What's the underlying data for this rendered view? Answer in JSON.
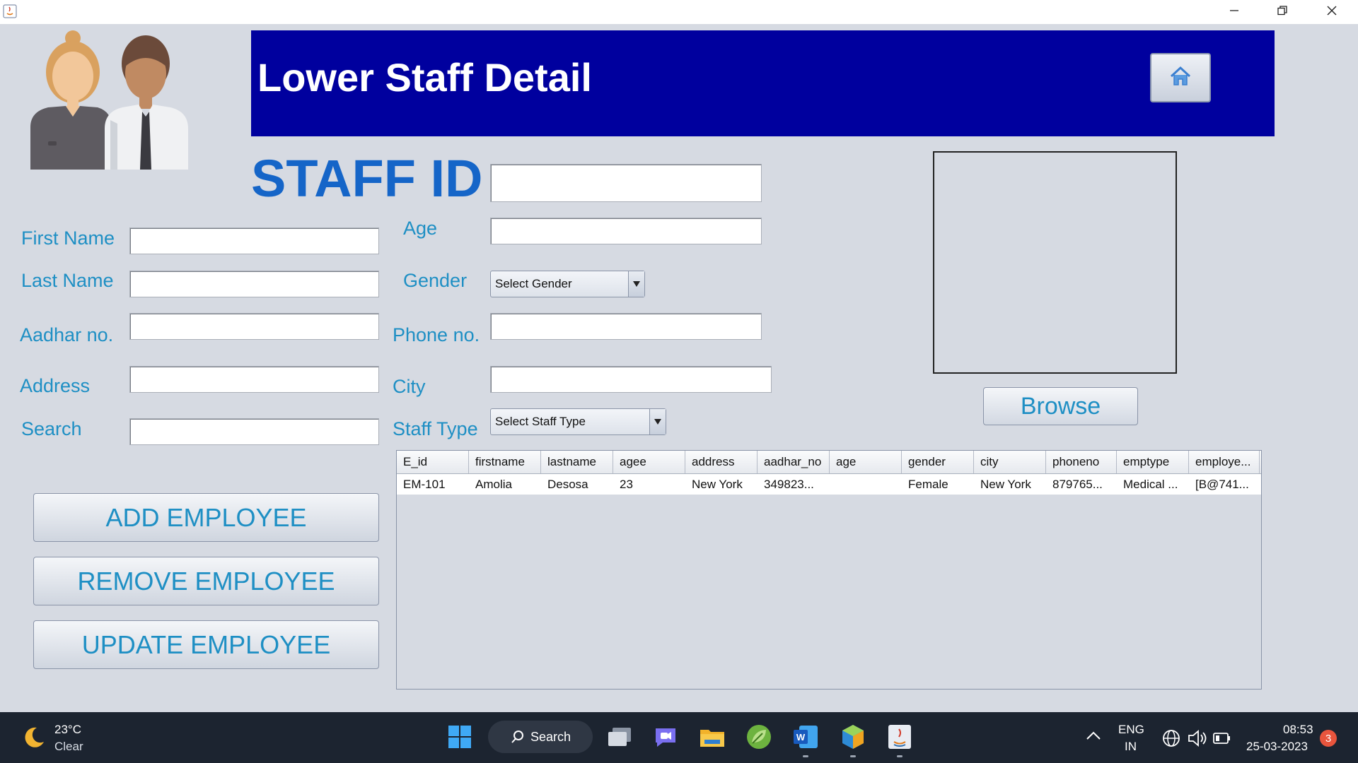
{
  "window": {
    "controls": {
      "minimize": "minimize-icon",
      "restore": "restore-icon",
      "close": "close-icon"
    }
  },
  "header": {
    "title": "Lower Staff Detail",
    "home_icon": "home-icon",
    "bg_color": "#00009e"
  },
  "form": {
    "staff_id_label": "STAFF ID",
    "staff_id_value": "",
    "labels": {
      "first_name": "First Name",
      "last_name": "Last Name",
      "aadhar": "Aadhar no.",
      "address": "Address",
      "search": "Search",
      "age": "Age",
      "gender": "Gender",
      "phone": "Phone no.",
      "city": "City",
      "staff_type": "Staff Type"
    },
    "values": {
      "first_name": "",
      "last_name": "",
      "aadhar": "",
      "address": "",
      "search": "",
      "age": "",
      "phone": "",
      "city": ""
    },
    "gender_select": "Select Gender",
    "staff_type_select": "Select Staff Type"
  },
  "photo": {
    "browse_label": "Browse"
  },
  "actions": {
    "add": "ADD EMPLOYEE",
    "remove": "REMOVE EMPLOYEE",
    "update": "UPDATE EMPLOYEE"
  },
  "table": {
    "columns": [
      "E_id",
      "firstname",
      "lastname",
      "agee",
      "address",
      "aadhar_no",
      "age",
      "gender",
      "city",
      "phoneno",
      "emptype",
      "employe..."
    ],
    "rows": [
      [
        "EM-101",
        "Amolia",
        "Desosa",
        "23",
        "New York",
        "349823...",
        "",
        "Female",
        "New York",
        "879765...",
        "Medical ...",
        "[B@741..."
      ]
    ]
  },
  "taskbar": {
    "weather_temp": "23°C",
    "weather_desc": "Clear",
    "search_label": "Search",
    "lang_top": "ENG",
    "lang_bottom": "IN",
    "time": "08:53",
    "date": "25-03-2023",
    "notification_count": "3"
  },
  "colors": {
    "label_blue": "#1e8fc4",
    "staff_id_blue": "#1565c8",
    "background": "#d6dae2"
  }
}
